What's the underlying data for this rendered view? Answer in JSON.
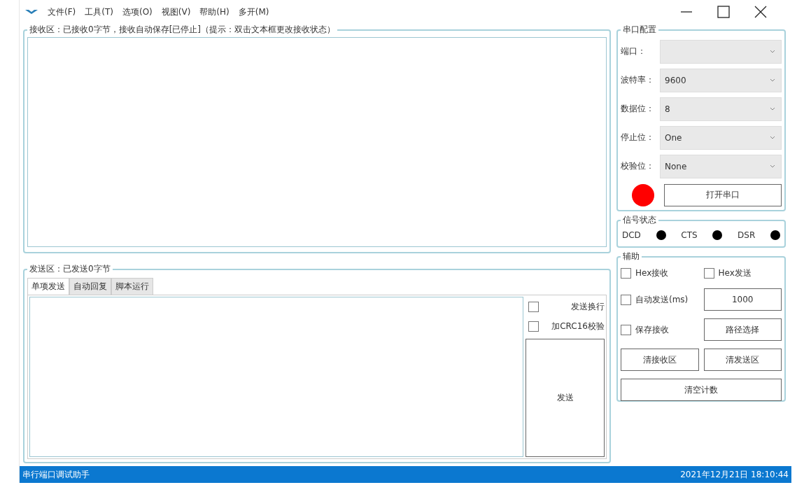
{
  "menu": [
    "文件(F)",
    "工具(T)",
    "选项(O)",
    "视图(V)",
    "帮助(H)",
    "多开(M)"
  ],
  "receive_area": {
    "title": "接收区：已接收0字节，接收自动保存[已停止]（提示：双击文本框更改接收状态）"
  },
  "send_area": {
    "title": "发送区：已发送0字节",
    "tabs": [
      {
        "label": "单项发送",
        "selected": true
      },
      {
        "label": "自动回复",
        "selected": false
      },
      {
        "label": "脚本运行",
        "selected": false
      }
    ],
    "options": [
      {
        "label": "发送换行",
        "checked": false
      },
      {
        "label": "加CRC16校验",
        "checked": false
      }
    ],
    "send_button": "发送"
  },
  "serial_config": {
    "title": "串口配置",
    "fields": [
      {
        "label": "端口："
      },
      {
        "label": "波特率：",
        "value": "9600"
      },
      {
        "label": "数据位：",
        "value": "8"
      },
      {
        "label": "停止位：",
        "value": "One"
      },
      {
        "label": "校验位：",
        "value": "None"
      }
    ],
    "port_open": false,
    "open_button": "打开串口"
  },
  "signal_status": {
    "title": "信号状态",
    "signals": [
      {
        "label": "DCD",
        "active": false
      },
      {
        "label": "CTS",
        "active": false
      },
      {
        "label": "DSR",
        "active": false
      }
    ]
  },
  "auxiliary": {
    "title": "辅助",
    "hex_receive": {
      "label": "Hex接收",
      "checked": false
    },
    "hex_send": {
      "label": "Hex发送",
      "checked": false
    },
    "auto_send": {
      "label": "自动发送(ms)",
      "checked": false,
      "interval": "1000"
    },
    "save_receive": {
      "label": "保存接收",
      "checked": false,
      "path_button": "路径选择"
    },
    "clear_receive_button": "清接收区",
    "clear_send_button": "清发送区",
    "clear_count_button": "清空计数"
  },
  "status_bar": {
    "app_name": "串行端口调试助手",
    "datetime": "2021年12月21日 18:10:44"
  }
}
